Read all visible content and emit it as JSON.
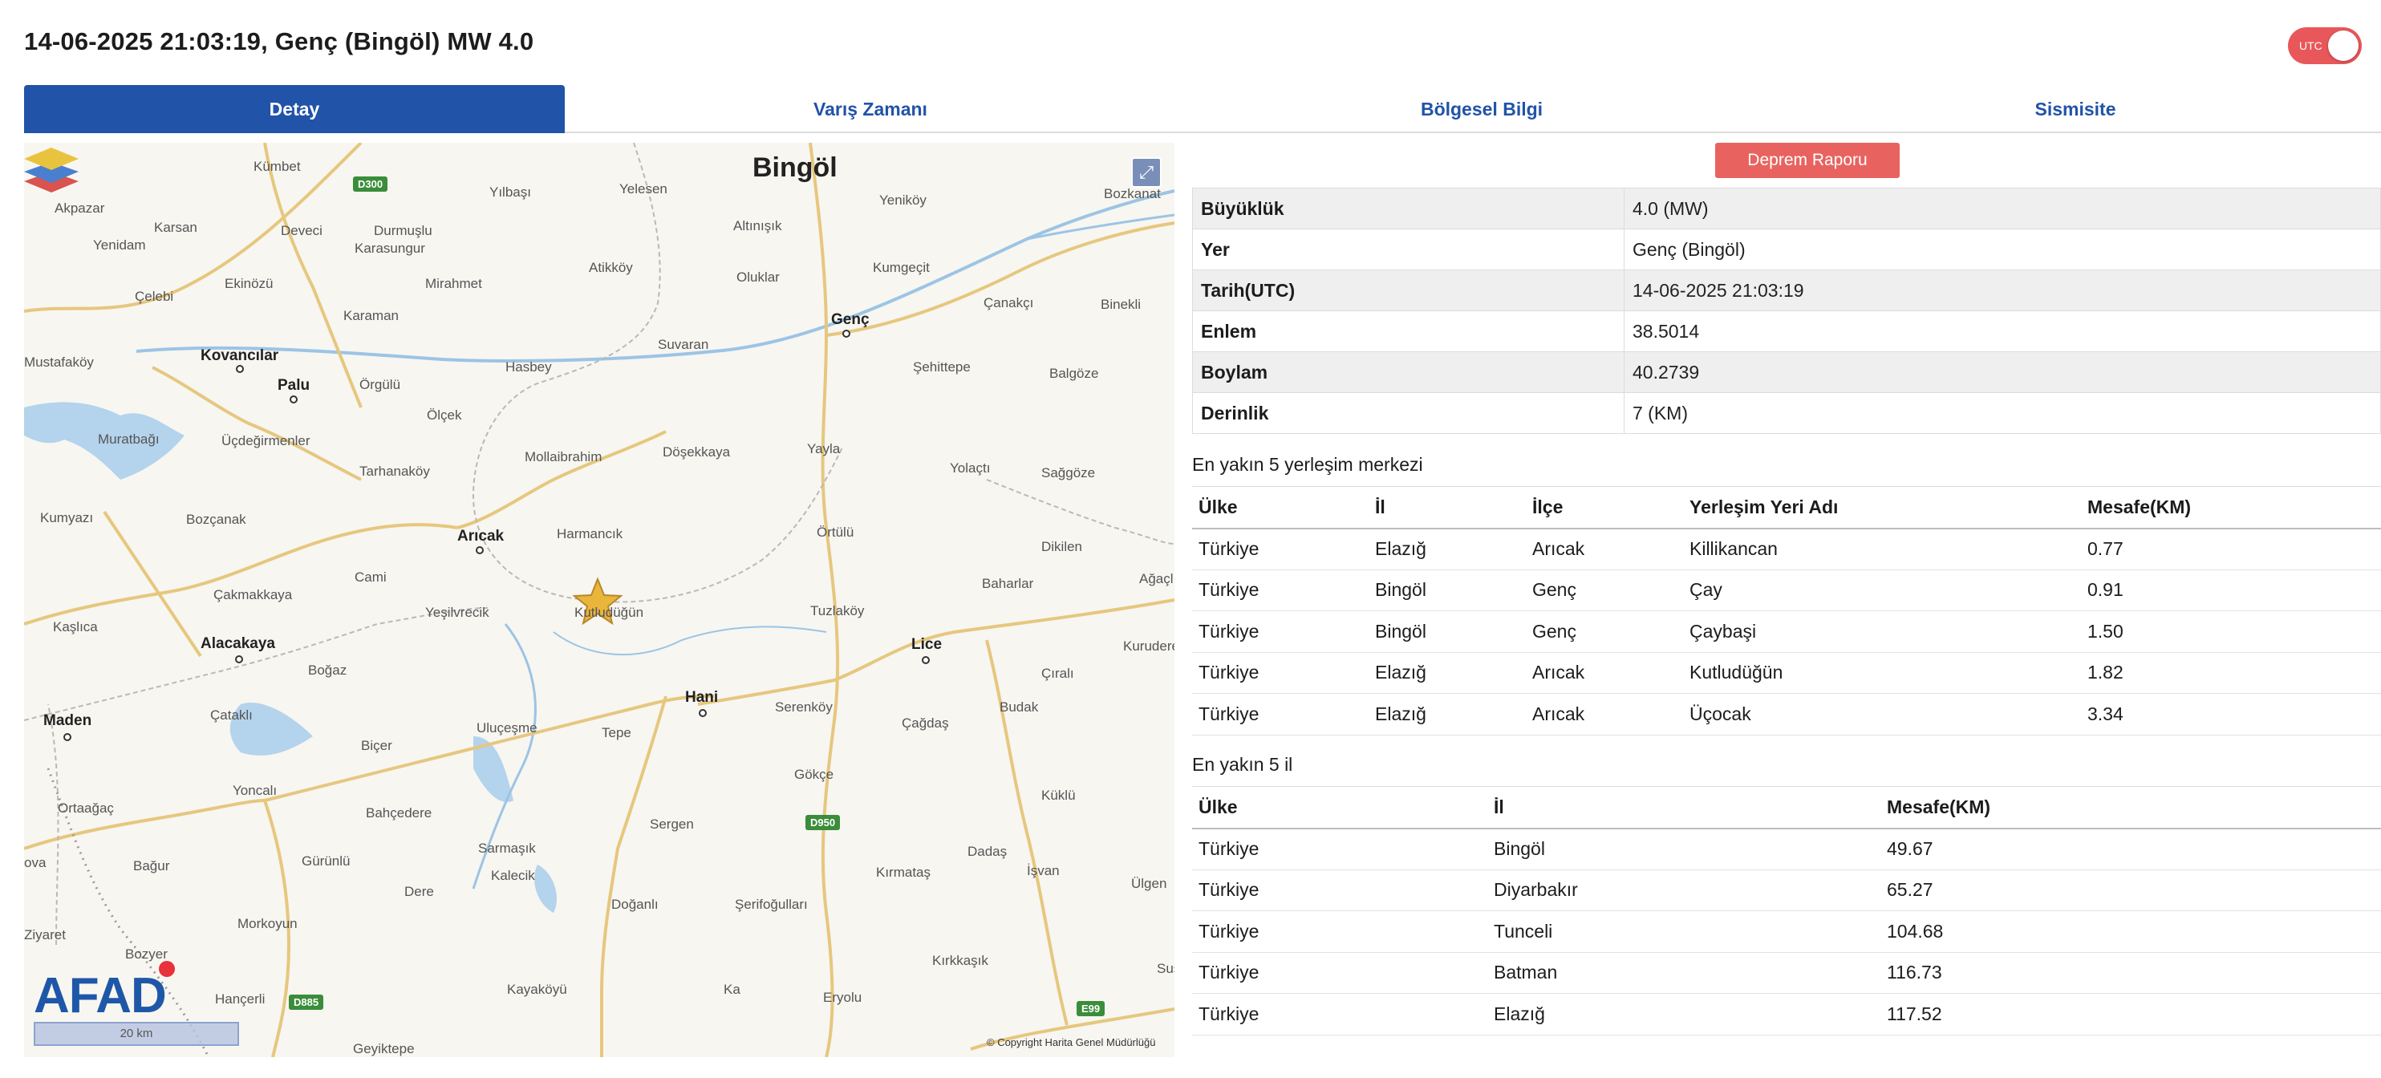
{
  "header": {
    "title": "14-06-2025 21:03:19, Genç (Bingöl) MW 4.0",
    "utc_label": "UTC"
  },
  "tabs": [
    {
      "label": "Detay",
      "active": true
    },
    {
      "label": "Varış Zamanı",
      "active": false
    },
    {
      "label": "Bölgesel Bilgi",
      "active": false
    },
    {
      "label": "Sismisite",
      "active": false
    }
  ],
  "map": {
    "labels": {
      "bingol": "Bingöl",
      "genc": "Genç",
      "kovancilar": "Kovancılar",
      "palu": "Palu",
      "aricak": "Arıcak",
      "alacakaya": "Alacakaya",
      "maden": "Maden",
      "hani": "Hani",
      "lice": "Lice",
      "kutludugun": "Kutludüğün",
      "kumbet": "Kümbet",
      "yilbasi": "Yılbaşı",
      "yelesen": "Yelesen",
      "yenikoy": "Yeniköy",
      "bozkanat": "Bozkanat",
      "akpazar": "Akpazar",
      "karsan": "Karsan",
      "deveci": "Deveci",
      "durmuslu": "Durmuşlu",
      "karasungur": "Karasungur",
      "yenidam": "Yenidam",
      "altinisik": "Altınışık",
      "atikkoy": "Atikköy",
      "oluklar": "Oluklar",
      "kumgecit": "Kumgeçit",
      "canakci": "Çanakçı",
      "binekli": "Binekli",
      "ekinozu": "Ekinözü",
      "mirahmet": "Mirahmet",
      "celebi": "Çelebi",
      "karaman": "Karaman",
      "suvaran": "Suvaran",
      "mustafakoy": "Mustafaköy",
      "hasbey": "Hasbey",
      "sehittepe": "Şehittepe",
      "balgoze": "Balgöze",
      "orgulu": "Örgülü",
      "olcek": "Ölçek",
      "muratbagi": "Muratbağı",
      "ucdegirmenler": "Üçdeğirmenler",
      "mollaibrahim": "Mollaibrahim",
      "dosekkaya": "Döşekkaya",
      "yayla": "Yayla",
      "tarhanakoy": "Tarhanaköy",
      "yolacti": "Yolaçtı",
      "saggoze": "Sağgöze",
      "kumyazi": "Kumyazı",
      "bozcanak": "Bozçanak",
      "harmancik": "Harmancık",
      "ortulu": "Örtülü",
      "dikilen": "Dikilen",
      "cami": "Cami",
      "baharlar": "Baharlar",
      "agacli": "Ağaçlı",
      "cakmakkaya": "Çakmakkaya",
      "vrecik": "Yeşilvrecik",
      "tuzlakoy": "Tuzlaköy",
      "kaslica": "Kaşlıca",
      "kuruderė": "Kuruderė",
      "bogaz": "Boğaz",
      "cirali": "Çıralı",
      "serenkoy": "Serenköy",
      "budak": "Budak",
      "catakli": "Çataklı",
      "ulucesme": "Uluçeşme",
      "tepe": "Tepe",
      "cagdas": "Çağdaş",
      "bicer": "Biçer",
      "gokce": "Gökçe",
      "yoncali": "Yoncalı",
      "ortaagac": "Ortaağaç",
      "bahcedere": "Bahçedere",
      "kuklu": "Küklü",
      "sergen": "Sergen",
      "sarmasik": "Sarmaşık",
      "dadas": "Dadaş",
      "ova": "ova",
      "bagur": "Bağur",
      "gurunlu": "Gürünlü",
      "kalecik": "Kalecik",
      "dere": "Dere",
      "kirmatas": "Kırmataş",
      "isvan": "İşvan",
      "ulgen": "Ülgen",
      "ziyaret": "Ziyaret",
      "dogalli": "Doğanlı",
      "serifogullari": "Şerifoğulları",
      "morkoyun": "Morkoyun",
      "bozyer": "Bozyer",
      "kirkkasik": "Kırkkaşık",
      "sus": "Sus",
      "hanceri": "Hançerli",
      "kayakoyu": "Kayaköyü",
      "ka": "Ka",
      "eryolu": "Eryolu",
      "geyiktepe": "Geyiktepe"
    },
    "roads": {
      "d300": "D300",
      "d950": "D950",
      "d885": "D885",
      "e99": "E99"
    },
    "logo_text": "AFAD",
    "scale_label": "20 km",
    "copyright": "© Copyright Harita Genel Müdürlüğü"
  },
  "report_button": "Deprem Raporu",
  "details": [
    {
      "key": "Büyüklük",
      "value": "4.0 (MW)"
    },
    {
      "key": "Yer",
      "value": "Genç (Bingöl)"
    },
    {
      "key": "Tarih(UTC)",
      "value": "14-06-2025 21:03:19"
    },
    {
      "key": "Enlem",
      "value": "38.5014"
    },
    {
      "key": "Boylam",
      "value": "40.2739"
    },
    {
      "key": "Derinlik",
      "value": "7 (KM)"
    }
  ],
  "settlements": {
    "title": "En yakın 5 yerleşim merkezi",
    "headers": [
      "Ülke",
      "İl",
      "İlçe",
      "Yerleşim Yeri Adı",
      "Mesafe(KM)"
    ],
    "rows": [
      [
        "Türkiye",
        "Elazığ",
        "Arıcak",
        "Killikancan",
        "0.77"
      ],
      [
        "Türkiye",
        "Bingöl",
        "Genç",
        "Çay",
        "0.91"
      ],
      [
        "Türkiye",
        "Bingöl",
        "Genç",
        "Çaybaşi",
        "1.50"
      ],
      [
        "Türkiye",
        "Elazığ",
        "Arıcak",
        "Kutludüğün",
        "1.82"
      ],
      [
        "Türkiye",
        "Elazığ",
        "Arıcak",
        "Üçocak",
        "3.34"
      ]
    ]
  },
  "provinces": {
    "title": "En yakın 5 il",
    "headers": [
      "Ülke",
      "İl",
      "Mesafe(KM)"
    ],
    "rows": [
      [
        "Türkiye",
        "Bingöl",
        "49.67"
      ],
      [
        "Türkiye",
        "Diyarbakır",
        "65.27"
      ],
      [
        "Türkiye",
        "Tunceli",
        "104.68"
      ],
      [
        "Türkiye",
        "Batman",
        "116.73"
      ],
      [
        "Türkiye",
        "Elazığ",
        "117.52"
      ]
    ]
  }
}
